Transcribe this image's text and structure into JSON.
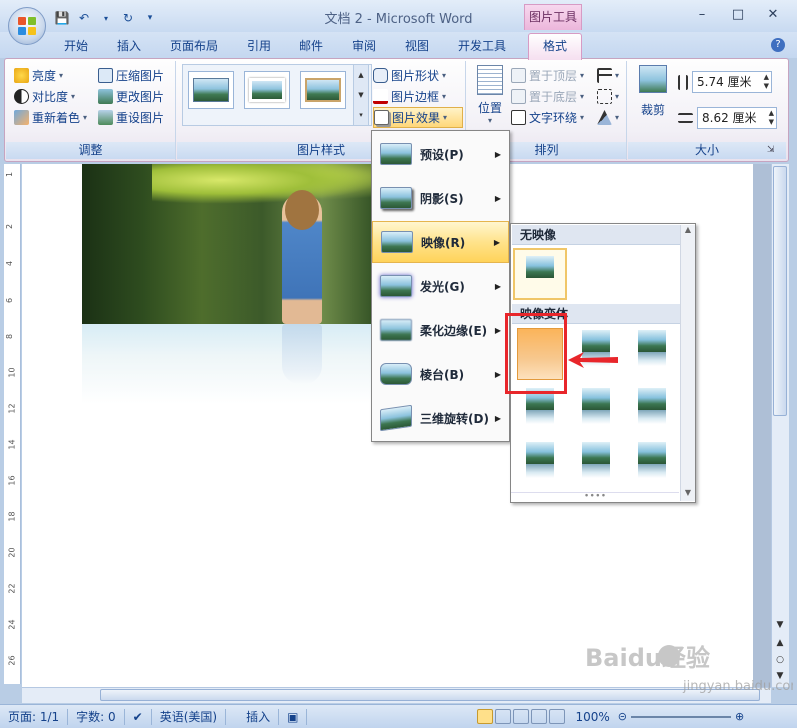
{
  "window": {
    "title": "文档 2 - Microsoft Word",
    "context_tab_group": "图片工具"
  },
  "tabs": [
    "开始",
    "插入",
    "页面布局",
    "引用",
    "邮件",
    "审阅",
    "视图",
    "开发工具"
  ],
  "active_tab": "格式",
  "ribbon": {
    "adjust": {
      "label": "调整",
      "items": [
        "亮度",
        "对比度",
        "重新着色",
        "压缩图片",
        "更改图片",
        "重设图片"
      ]
    },
    "picture_styles": {
      "label": "图片样式",
      "items": [
        "图片形状",
        "图片边框",
        "图片效果"
      ]
    },
    "arrange": {
      "label": "排列",
      "position": "位置",
      "items": [
        "置于顶层",
        "置于底层",
        "文字环绕"
      ]
    },
    "size": {
      "label": "大小",
      "crop": "裁剪",
      "height": "5.74 厘米",
      "width": "8.62 厘米"
    }
  },
  "effects_menu": {
    "items": [
      {
        "label": "预设(P)"
      },
      {
        "label": "阴影(S)"
      },
      {
        "label": "映像(R)"
      },
      {
        "label": "发光(G)"
      },
      {
        "label": "柔化边缘(E)"
      },
      {
        "label": "棱台(B)"
      },
      {
        "label": "三维旋转(D)"
      }
    ],
    "active_index": 2
  },
  "reflection_gallery": {
    "section_none": "无映像",
    "section_variants": "映像变体"
  },
  "ruler": [
    "1",
    "2",
    "4",
    "6",
    "8",
    "10",
    "12",
    "14",
    "16",
    "18",
    "20",
    "22",
    "24",
    "26"
  ],
  "status": {
    "page": "页面: 1/1",
    "words": "字数: 0",
    "language": "英语(美国)",
    "mode": "插入",
    "zoom": "100%"
  },
  "watermark": {
    "brand": "Baidu经验",
    "url": "jingyan.baidu.com"
  },
  "colors": {
    "accent_blue": "#15428b",
    "context_pink": "#ecb6db",
    "highlight": "#ffd35a",
    "annotation_red": "#e8262b"
  }
}
